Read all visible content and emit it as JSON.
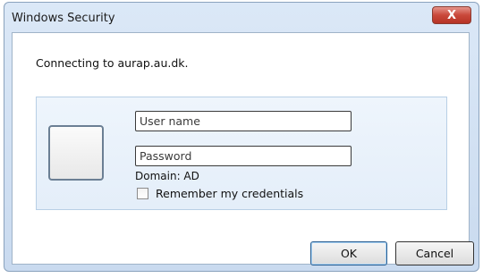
{
  "window": {
    "title": "Windows Security",
    "close_glyph": "X"
  },
  "message": "Connecting to aurap.au.dk.",
  "credentials": {
    "username_placeholder": "User name",
    "password_placeholder": "Password",
    "domain_text": "Domain: AD",
    "remember_label": "Remember my credentials",
    "remember_checked": false
  },
  "buttons": {
    "ok_label": "OK",
    "cancel_label": "Cancel"
  },
  "icons": {
    "user_tile": "user-avatar-icon",
    "close": "close-icon"
  }
}
